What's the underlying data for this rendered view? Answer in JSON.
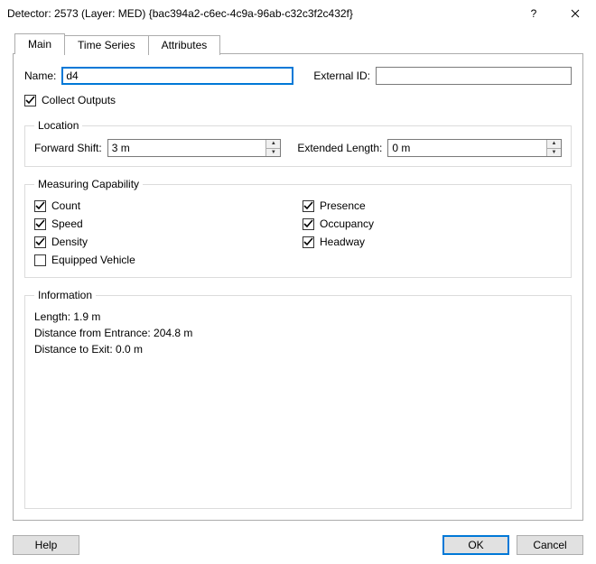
{
  "window": {
    "title": "Detector: 2573 (Layer: MED) {bac394a2-c6ec-4c9a-96ab-c32c3f2c432f}"
  },
  "tabs": {
    "main": "Main",
    "time_series": "Time Series",
    "attributes": "Attributes",
    "active": "main"
  },
  "fields": {
    "name_label": "Name:",
    "name_value": "d4",
    "external_id_label": "External ID:",
    "external_id_value": ""
  },
  "collect_outputs": {
    "label": "Collect Outputs",
    "checked": true
  },
  "location": {
    "legend": "Location",
    "forward_shift_label": "Forward Shift:",
    "forward_shift_value": "3 m",
    "extended_length_label": "Extended Length:",
    "extended_length_value": "0 m"
  },
  "measuring": {
    "legend": "Measuring Capability",
    "count": {
      "label": "Count",
      "checked": true
    },
    "speed": {
      "label": "Speed",
      "checked": true
    },
    "density": {
      "label": "Density",
      "checked": true
    },
    "equipped": {
      "label": "Equipped Vehicle",
      "checked": false
    },
    "presence": {
      "label": "Presence",
      "checked": true
    },
    "occupancy": {
      "label": "Occupancy",
      "checked": true
    },
    "headway": {
      "label": "Headway",
      "checked": true
    }
  },
  "information": {
    "legend": "Information",
    "length": "Length: 1.9 m",
    "distance_from_entrance": "Distance from Entrance: 204.8 m",
    "distance_to_exit": "Distance to Exit: 0.0 m"
  },
  "buttons": {
    "help": "Help",
    "ok": "OK",
    "cancel": "Cancel"
  }
}
